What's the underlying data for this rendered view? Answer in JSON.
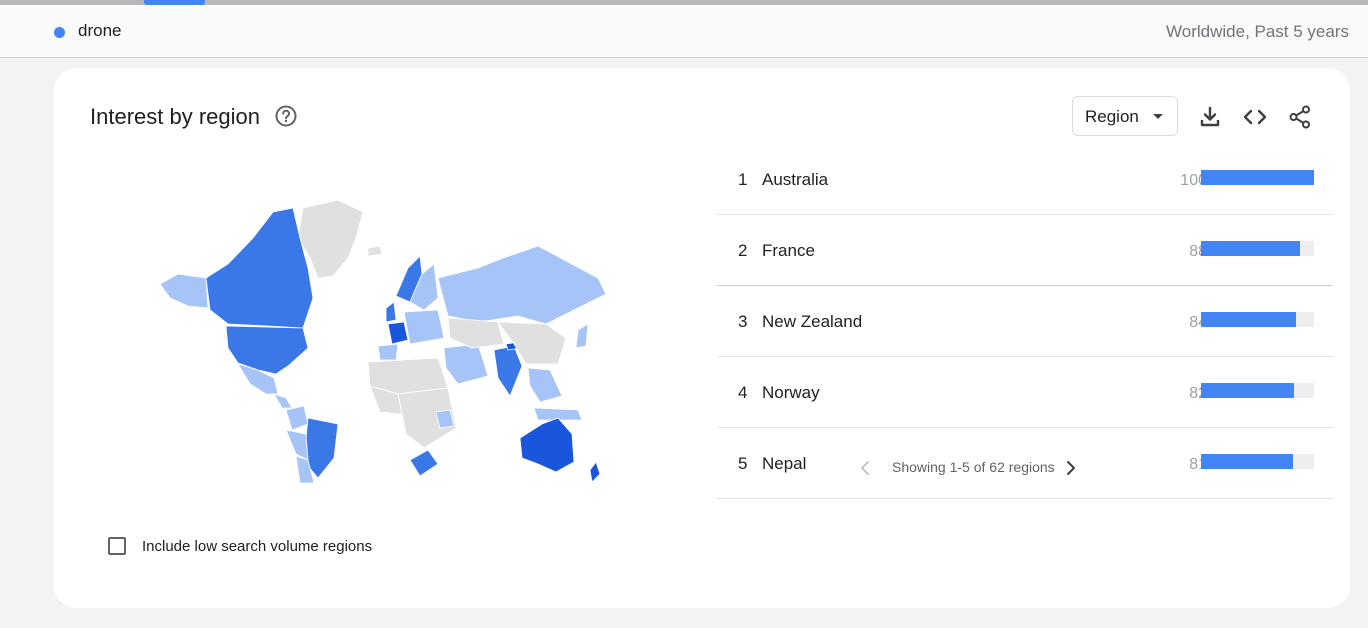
{
  "topbar": {
    "term": "drone",
    "term_color": "#4285f4",
    "scope": "Worldwide, Past 5 years"
  },
  "card": {
    "title": "Interest by region",
    "help_icon": "help-circle-icon",
    "resolution_select": {
      "selected": "Region"
    },
    "tools": [
      "download-icon",
      "embed-code-icon",
      "share-icon"
    ]
  },
  "map": {
    "legend_colors": {
      "high": "#1a56db",
      "mid": "#3b78e7",
      "low": "#a6c4f7",
      "no_data": "#e0e0e0"
    }
  },
  "checkbox": {
    "label": "Include low search volume regions",
    "checked": false
  },
  "ranking": {
    "rows": [
      {
        "rank": "1",
        "name": "Australia",
        "value": "100",
        "score": 100
      },
      {
        "rank": "2",
        "name": "France",
        "value": "88",
        "score": 88
      },
      {
        "rank": "3",
        "name": "New Zealand",
        "value": "84",
        "score": 84
      },
      {
        "rank": "4",
        "name": "Norway",
        "value": "82",
        "score": 82
      },
      {
        "rank": "5",
        "name": "Nepal",
        "value": "81",
        "score": 81
      }
    ],
    "pagination": {
      "text": "Showing 1-5 of 62 regions"
    }
  }
}
